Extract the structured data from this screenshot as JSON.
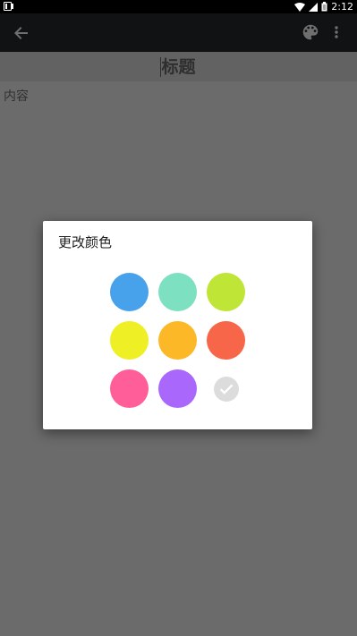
{
  "status_bar": {
    "time": "2:12",
    "icons": [
      "notification-icon",
      "wifi-icon",
      "signal-icon",
      "battery-icon"
    ]
  },
  "app_bar": {
    "back_icon": "arrow-left-icon",
    "actions": [
      "palette-icon",
      "more-vert-icon"
    ]
  },
  "editor": {
    "title": "标题",
    "content": "内容"
  },
  "dialog": {
    "title": "更改颜色",
    "colors": [
      {
        "name": "blue",
        "hex": "#48A2EB"
      },
      {
        "name": "teal",
        "hex": "#7DE0C0"
      },
      {
        "name": "lime",
        "hex": "#BFE636"
      },
      {
        "name": "yellow",
        "hex": "#EFEF26"
      },
      {
        "name": "amber",
        "hex": "#FDB827"
      },
      {
        "name": "orange-red",
        "hex": "#F76649"
      },
      {
        "name": "pink",
        "hex": "#FF5E98"
      },
      {
        "name": "purple",
        "hex": "#A968FB"
      },
      {
        "name": "none-selected",
        "hex": "#DCDCDC",
        "selected": true,
        "icon": "check-icon"
      }
    ]
  },
  "colors": {
    "overlay_bg": "#6B6B6B",
    "app_bar_bg": "#111214",
    "dialog_bg": "#FFFFFF"
  }
}
